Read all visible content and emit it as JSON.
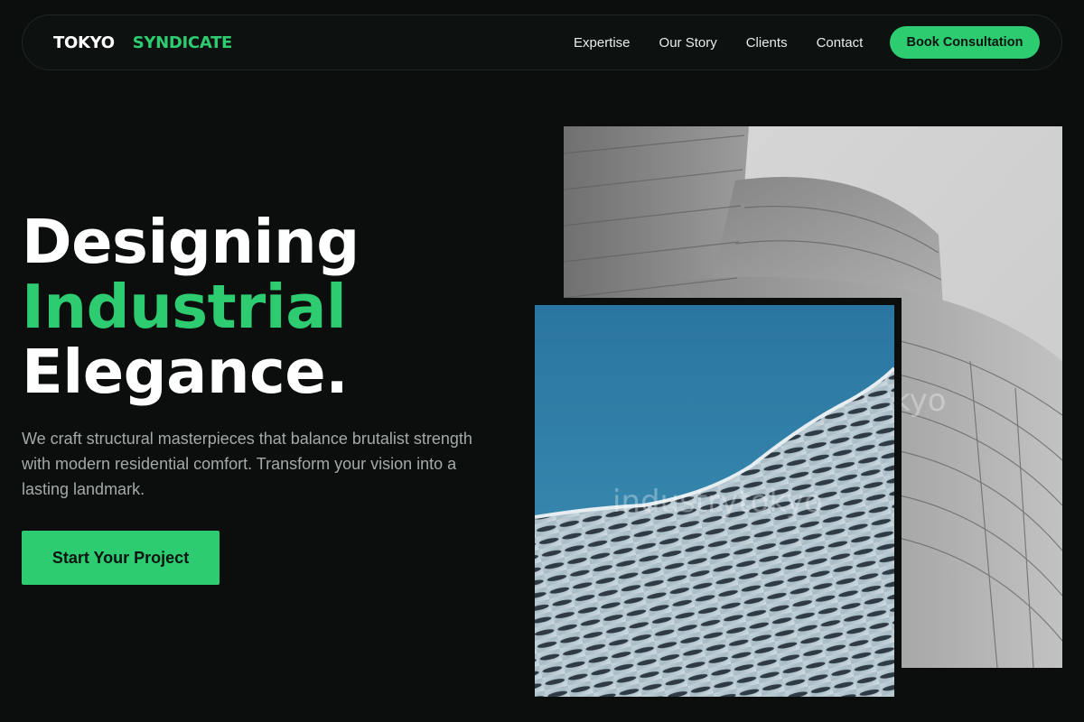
{
  "brand": {
    "part1": "TOKYO",
    "part2": "SYNDICATE"
  },
  "nav": {
    "links": [
      "Expertise",
      "Our Story",
      "Clients",
      "Contact"
    ],
    "cta_label": "Book Consultation"
  },
  "hero": {
    "headline_line1": "Designing",
    "headline_line2": "Industrial",
    "headline_line3": "Elegance.",
    "subtext": "We craft structural masterpieces that balance brutalist strength with modern residential comfort. Transform your vision into a lasting landmark.",
    "cta_label": "Start Your Project"
  },
  "images": {
    "back_watermark": "tokyo",
    "front_watermark": "industrytokyo"
  },
  "colors": {
    "background": "#0b0e0d",
    "accent": "#2ecc71",
    "text": "#ffffff",
    "muted_text": "#a3aaa7"
  }
}
